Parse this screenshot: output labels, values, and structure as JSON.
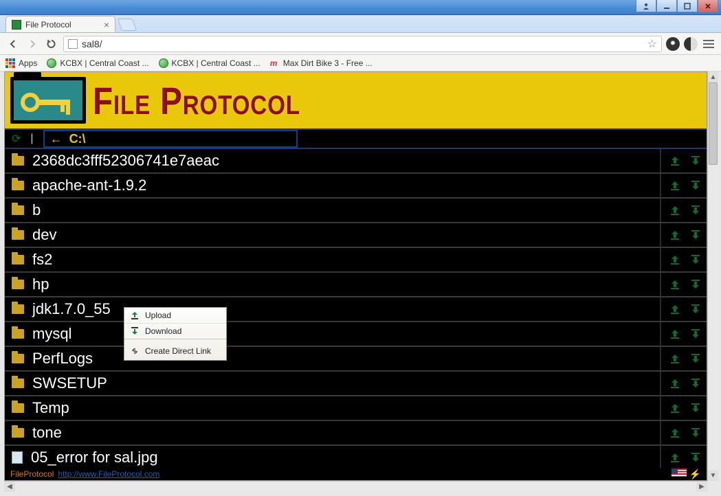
{
  "window": {
    "tab_title": "File Protocol",
    "url": "sal8/"
  },
  "bookmarks": {
    "apps": "Apps",
    "items": [
      "KCBX | Central Coast ...",
      "KCBX | Central Coast ...",
      "Max Dirt Bike 3 - Free ..."
    ]
  },
  "header": {
    "title": "File Protocol"
  },
  "pathbar": {
    "path": "C:\\"
  },
  "files": [
    {
      "name": "2368dc3fff52306741e7aeac",
      "type": "folder"
    },
    {
      "name": "apache-ant-1.9.2",
      "type": "folder"
    },
    {
      "name": "b",
      "type": "folder"
    },
    {
      "name": "dev",
      "type": "folder"
    },
    {
      "name": "fs2",
      "type": "folder"
    },
    {
      "name": "hp",
      "type": "folder"
    },
    {
      "name": "jdk1.7.0_55",
      "type": "folder"
    },
    {
      "name": "mysql",
      "type": "folder"
    },
    {
      "name": "PerfLogs",
      "type": "folder"
    },
    {
      "name": "SWSETUP",
      "type": "folder"
    },
    {
      "name": "Temp",
      "type": "folder"
    },
    {
      "name": "tone",
      "type": "folder"
    },
    {
      "name": "05_error for sal.jpg",
      "type": "file"
    }
  ],
  "context_menu": {
    "upload": "Upload",
    "download": "Download",
    "create_link": "Create Direct Link"
  },
  "footer": {
    "brand": "FileProtocol",
    "link": "http://www.FileProtocol.com"
  }
}
